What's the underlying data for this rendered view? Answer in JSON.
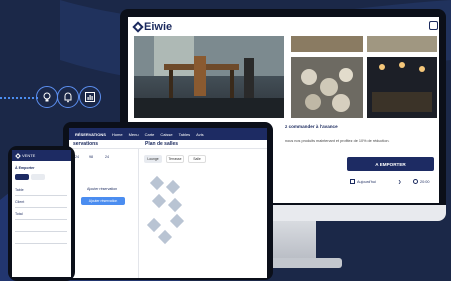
{
  "monitor": {
    "app_logo": "Eiwie",
    "promo_title": "z commander à l'avance",
    "promo_text": "nous nos produits maintenant et profitez de 10% de réduction.",
    "order_button": "A EMPORTER",
    "date_label": "Aujourd'hui",
    "time_label": "20:00"
  },
  "tablet": {
    "nav_title": "RÉSERVATIONS",
    "nav_items": [
      "Home",
      "Menu",
      "Carte",
      "Caisse",
      "Tables",
      "Avis"
    ],
    "section_title": "servations",
    "room_title": "Plan de salles",
    "room_tabs": [
      "Lounge",
      "Terrasse",
      "Salle"
    ],
    "side_heading": "Ajouter réservation",
    "side_button": "Ajouter réservation",
    "counts": [
      "24",
      "98",
      "24"
    ]
  },
  "phone": {
    "header": "VENTE",
    "section": "À Emporter",
    "rows": [
      "Table",
      "Client",
      "Total"
    ]
  },
  "colors": {
    "background": "#1a2846",
    "brand": "#1d2b63",
    "accent": "#4b8df0"
  }
}
